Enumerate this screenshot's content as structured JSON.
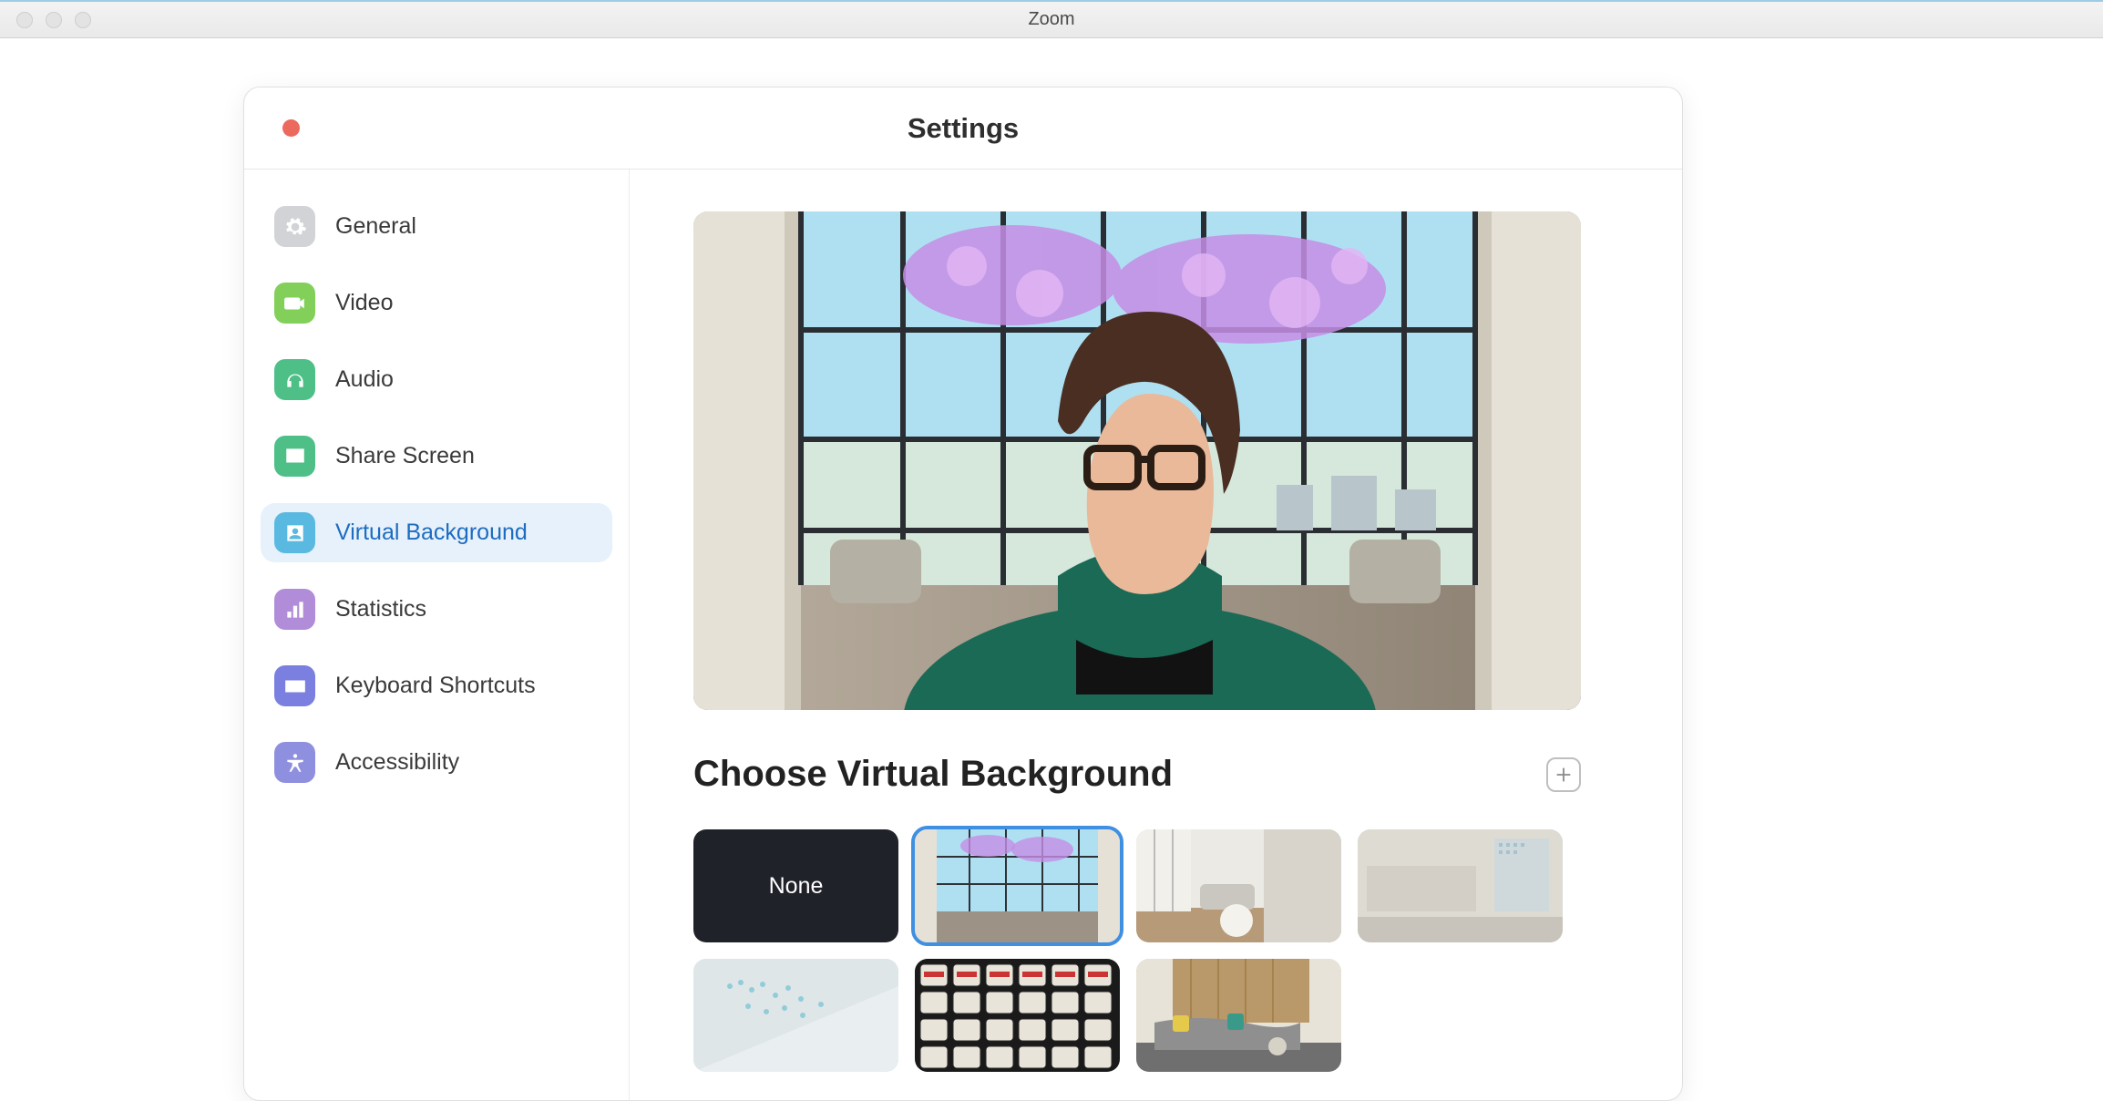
{
  "app": {
    "title": "Zoom"
  },
  "settings": {
    "title": "Settings",
    "sidebar": {
      "items": [
        {
          "label": "General"
        },
        {
          "label": "Video"
        },
        {
          "label": "Audio"
        },
        {
          "label": "Share Screen"
        },
        {
          "label": "Virtual Background"
        },
        {
          "label": "Statistics"
        },
        {
          "label": "Keyboard Shortcuts"
        },
        {
          "label": "Accessibility"
        }
      ],
      "active_index": 4
    },
    "virtual_background": {
      "section_title": "Choose Virtual Background",
      "none_label": "None",
      "selected_index": 1,
      "thumbnails": [
        {
          "kind": "none"
        },
        {
          "kind": "lobby-atrium"
        },
        {
          "kind": "modern-living"
        },
        {
          "kind": "concrete-wall"
        },
        {
          "kind": "glass-pattern"
        },
        {
          "kind": "cans-pattern"
        },
        {
          "kind": "lounge-sofa"
        }
      ]
    }
  }
}
